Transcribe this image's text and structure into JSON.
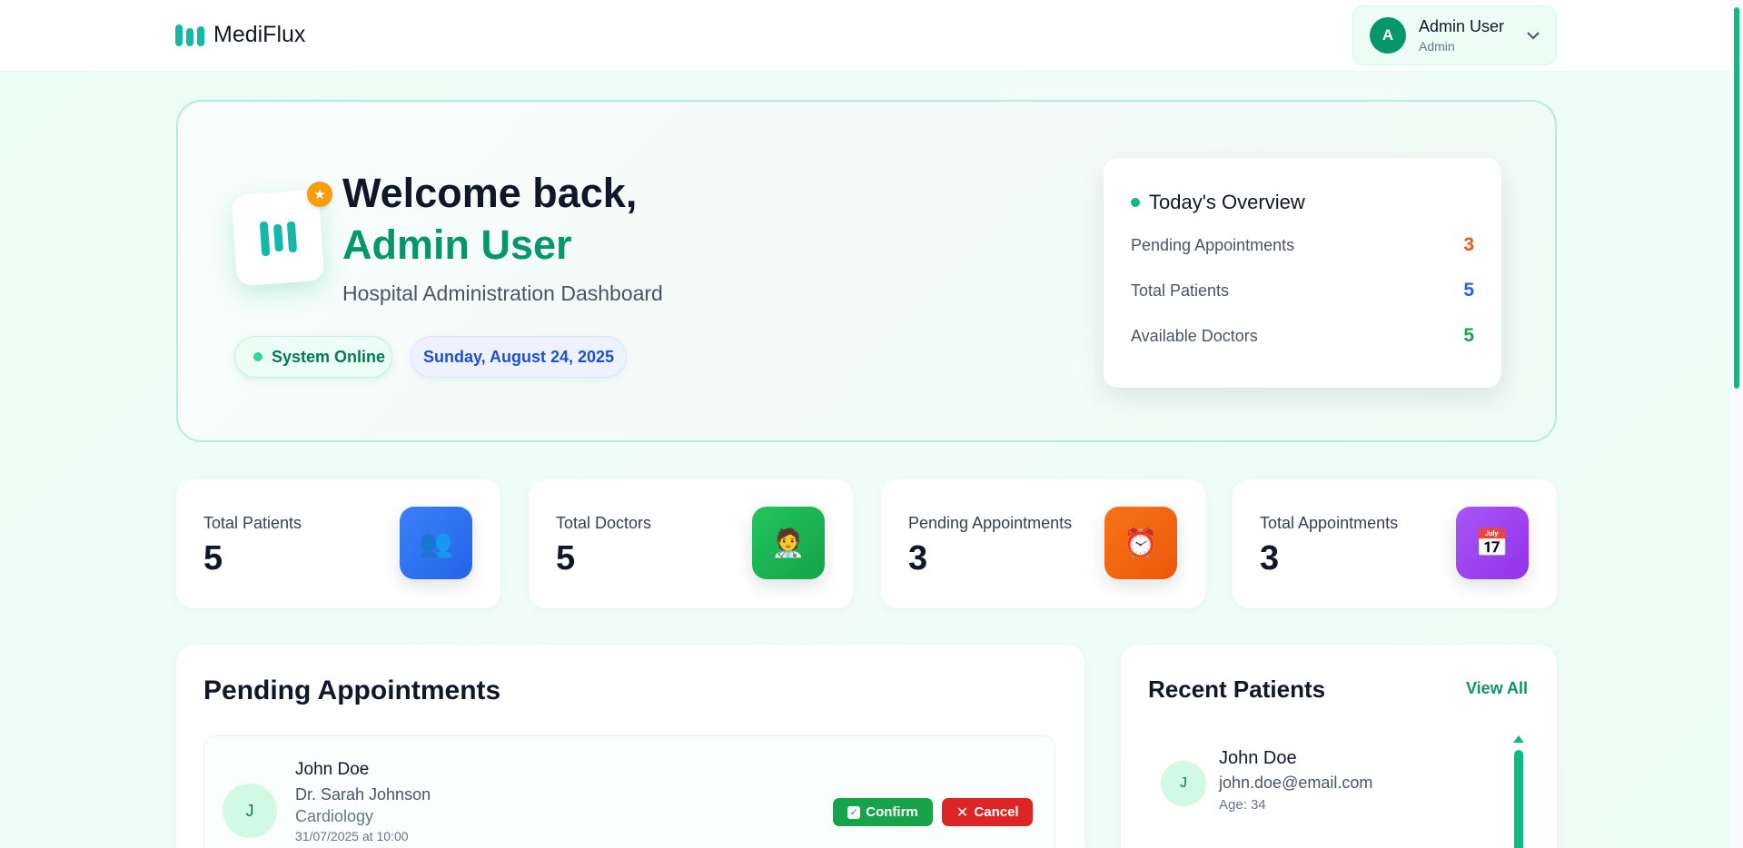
{
  "brand": {
    "name": "MediFlux"
  },
  "user": {
    "initial": "A",
    "name": "Admin User",
    "role": "Admin"
  },
  "hero": {
    "welcome": "Welcome back,",
    "name": "Admin User",
    "subtitle": "Hospital Administration Dashboard",
    "status": "System Online",
    "date": "Sunday, August 24, 2025"
  },
  "overview": {
    "title": "Today's Overview",
    "rows": [
      {
        "label": "Pending Appointments",
        "value": "3",
        "color": "#ea580c"
      },
      {
        "label": "Total Patients",
        "value": "5",
        "color": "#2563eb"
      },
      {
        "label": "Available Doctors",
        "value": "5",
        "color": "#16a34a"
      }
    ]
  },
  "stats": [
    {
      "label": "Total Patients",
      "value": "5",
      "icon": "👥",
      "icon_name": "patients-icon",
      "color": "#2563eb"
    },
    {
      "label": "Total Doctors",
      "value": "5",
      "icon": "🧑‍⚕️",
      "icon_name": "doctor-icon",
      "color": "#16a34a"
    },
    {
      "label": "Pending Appointments",
      "value": "3",
      "icon": "⏰",
      "icon_name": "alarm-clock-icon",
      "color": "#ea580c"
    },
    {
      "label": "Total Appointments",
      "value": "3",
      "icon": "📅",
      "icon_name": "calendar-icon",
      "color": "#9333ea"
    }
  ],
  "pending": {
    "title": "Pending Appointments",
    "items": [
      {
        "initial": "J",
        "patient": "John Doe",
        "doctor": "Dr. Sarah Johnson",
        "specialty": "Cardiology",
        "when": "31/07/2025 at 10:00",
        "confirm_label": "Confirm",
        "cancel_label": "Cancel"
      }
    ]
  },
  "recent": {
    "title": "Recent Patients",
    "view_all": "View All",
    "items": [
      {
        "initial": "J",
        "name": "John Doe",
        "email": "john.doe@email.com",
        "age": "Age: 34"
      }
    ]
  }
}
